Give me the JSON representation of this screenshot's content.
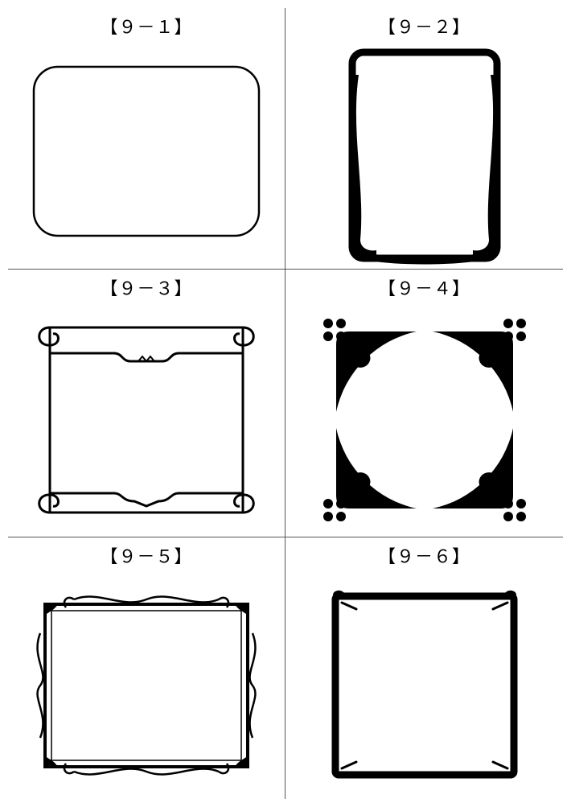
{
  "cells": [
    {
      "label": "【９－１】"
    },
    {
      "label": "【９－２】"
    },
    {
      "label": "【９－３】"
    },
    {
      "label": "【９－４】"
    },
    {
      "label": "【９－５】"
    },
    {
      "label": "【９－６】"
    }
  ]
}
